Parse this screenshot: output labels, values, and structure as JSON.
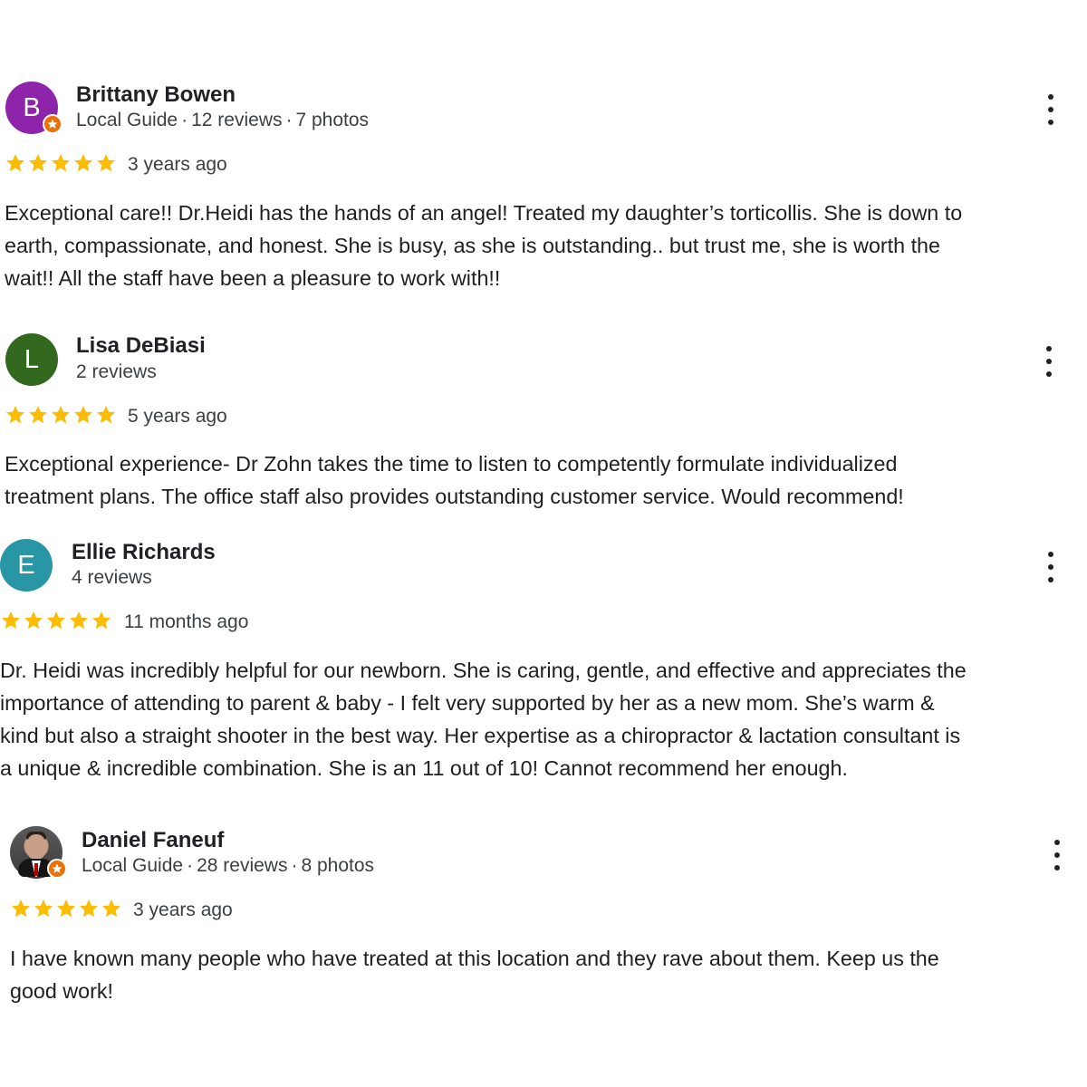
{
  "reviews": [
    {
      "name": "Brittany Bowen",
      "avatar_letter": "B",
      "avatar_color": "#8e24aa",
      "avatar_type": "letter",
      "local_guide_badge": true,
      "meta": [
        "Local Guide",
        "12 reviews",
        "7 photos"
      ],
      "meta_separator": "·",
      "rating": 5,
      "time": "3 years ago",
      "text_lines": [
        "Exceptional care!! Dr.Heidi has the hands of an angel! Treated my daughter’s torticollis. She is down to",
        "earth, compassionate, and honest. She is busy, as she is outstanding.. but trust me, she is worth the",
        "wait!! All the staff have been a pleasure to work with!!"
      ]
    },
    {
      "name": "Lisa DeBiasi",
      "avatar_letter": "L",
      "avatar_color": "#33691e",
      "avatar_type": "letter",
      "local_guide_badge": false,
      "meta": [
        "2 reviews"
      ],
      "meta_separator": "·",
      "rating": 5,
      "time": "5 years ago",
      "text_lines": [
        "Exceptional experience- Dr Zohn takes the time to listen to competently formulate individualized",
        "treatment plans. The office staff also provides outstanding customer service. Would recommend!"
      ]
    },
    {
      "name": "Ellie Richards",
      "avatar_letter": "E",
      "avatar_color": "#2996a6",
      "avatar_type": "letter",
      "local_guide_badge": false,
      "meta": [
        "4 reviews"
      ],
      "meta_separator": "·",
      "rating": 5,
      "time": "11 months ago",
      "text_lines": [
        "Dr. Heidi was incredibly helpful for our newborn. She is caring, gentle, and effective and appreciates the",
        "importance of attending to parent & baby - I felt very supported by her as a new mom. She’s warm &",
        "kind but also a straight shooter in the best way. Her expertise as a chiropractor & lactation consultant is",
        "a unique & incredible combination. She is an 11 out of 10! Cannot recommend her enough."
      ]
    },
    {
      "name": "Daniel Faneuf",
      "avatar_letter": "",
      "avatar_color": "#4a4a4a",
      "avatar_type": "photo",
      "local_guide_badge": true,
      "meta": [
        "Local Guide",
        "28 reviews",
        "8 photos"
      ],
      "meta_separator": "·",
      "rating": 5,
      "time": "3 years ago",
      "text_lines": [
        "I have known many people who have treated at this location and they rave about them. Keep us the",
        "good work!"
      ]
    }
  ],
  "icons": {
    "star": "star-icon",
    "more": "more-vert-icon",
    "badge": "local-guide-badge-icon"
  },
  "colors": {
    "star": "#fbbc04",
    "badge": "#e8710a",
    "text": "#1f1f1f",
    "meta": "#3c4043"
  }
}
